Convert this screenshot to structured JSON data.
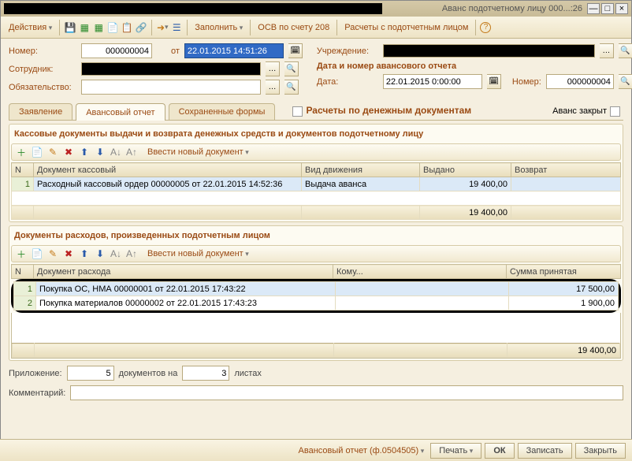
{
  "window": {
    "title": "Аванс подотчетному лицу 000...:26"
  },
  "toolbar": {
    "actions": "Действия",
    "fill": "Заполнить",
    "osv": "ОСВ по счету 208",
    "settlements": "Расчеты с подотчетным лицом"
  },
  "header": {
    "number_lbl": "Номер:",
    "number": "000000004",
    "from_lbl": "от",
    "date": "22.01.2015 14:51:26",
    "employee_lbl": "Сотрудник:",
    "obligation_lbl": "Обязательство:",
    "org_lbl": "Учреждение:",
    "report_hdr": "Дата и номер авансового отчета",
    "report_date_lbl": "Дата:",
    "report_date": "22.01.2015 0:00:00",
    "report_num_lbl": "Номер:",
    "report_num": "000000004"
  },
  "tabs": {
    "t1": "Заявление",
    "t2": "Авансовый отчет",
    "t3": "Сохраненные формы"
  },
  "cash_checkbox": "Расчеты по денежным документам",
  "closed_checkbox": "Аванс закрыт",
  "section1": {
    "title": "Кассовые документы выдачи и возврата денежных средств и документов подотчетному лицу",
    "newdoc": "Ввести новый документ",
    "cols": {
      "n": "N",
      "doc": "Документ кассовый",
      "move": "Вид движения",
      "issued": "Выдано",
      "ret": "Возврат"
    },
    "rows": [
      {
        "n": "1",
        "doc": "Расходный кассовый ордер 00000005 от 22.01.2015 14:52:36",
        "move": "Выдача аванса",
        "issued": "19 400,00",
        "ret": ""
      }
    ],
    "total_issued": "19 400,00"
  },
  "section2": {
    "title": "Документы расходов, произведенных подотчетным лицом",
    "newdoc": "Ввести новый документ",
    "cols": {
      "n": "N",
      "doc": "Документ расхода",
      "whom": "Кому...",
      "sum": "Сумма принятая"
    },
    "rows": [
      {
        "n": "1",
        "doc": "Покупка ОС, НМА 00000001 от 22.01.2015 17:43:22",
        "whom": "",
        "sum": "17 500,00"
      },
      {
        "n": "2",
        "doc": "Покупка материалов 00000002 от 22.01.2015 17:43:23",
        "whom": "",
        "sum": "1 900,00"
      }
    ],
    "total_sum": "19 400,00"
  },
  "attachment": {
    "lbl": "Приложение:",
    "cnt1": "5",
    "mid": "документов на",
    "cnt2": "3",
    "tail": "листах"
  },
  "comment_lbl": "Комментарий:",
  "footer": {
    "form": "Авансовый отчет (ф.0504505)",
    "print": "Печать",
    "ok": "ОК",
    "save": "Записать",
    "close": "Закрыть"
  }
}
